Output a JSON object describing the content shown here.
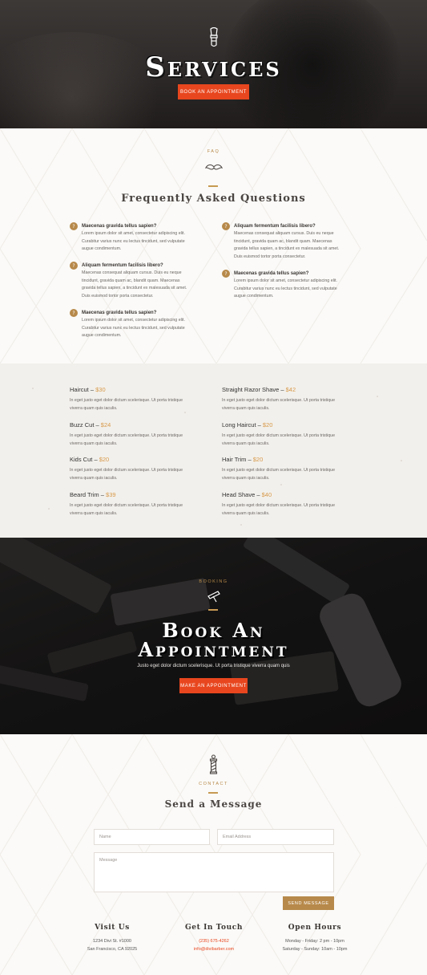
{
  "hero": {
    "title": "Services",
    "button": "Book An Appointment"
  },
  "faq": {
    "eyebrow": "FAQ",
    "title": "Frequently Asked Questions",
    "badge": "?",
    "left": [
      {
        "q": "Maecenas gravida tellus sapien?",
        "a": [
          "Lorem ipsum dolor sit amet, consectetur adipiscing elit.",
          "Curabitur varius nunc eu lectus tincidunt, sed vulputate",
          "augue condimentum."
        ]
      },
      {
        "q": "Aliquam fermentum facilisis libero?",
        "a": [
          "Maecenas consequat aliquam cursus. Duis eu neque",
          "tincidunt, gravida quam ac, blandit quam. Maecenas",
          "gravida tellus sapien, a tincidunt ex malesuada sit amet.",
          "Duis euismod tortor porta consectetur."
        ]
      },
      {
        "q": "Maecenas gravida tellus sapien?",
        "a": [
          "Lorem ipsum dolor sit amet, consectetur adipiscing elit.",
          "Curabitur varius nunc eu lectus tincidunt, sed vulputate",
          "augue condimentum."
        ]
      }
    ],
    "right": [
      {
        "q": "Aliquam fermentum facilisis libero?",
        "a": [
          "Maecenas consequat aliquam cursus. Duis eu neque",
          "tincidunt, gravida quam ac, blandit quam. Maecenas",
          "gravida tellus sapien, a tincidunt ex malesuada sit amet.",
          "Duis euismod tortor porta consectetur."
        ]
      },
      {
        "q": "Maecenas gravida tellus sapien?",
        "a": [
          "Lorem ipsum dolor sit amet, consectetur adipiscing elit.",
          "Curabitur varius nunc eu lectus tincidunt, sed vulputate",
          "augue condimentum."
        ]
      }
    ]
  },
  "prices": {
    "separator": " – ",
    "desc": [
      "In eget justo eget dolor dictum scelerisque. Ut porta tristique",
      "viverra quam quis iaculis."
    ],
    "left": [
      {
        "name": "Haircut",
        "price": "$30"
      },
      {
        "name": "Buzz Cut",
        "price": "$24"
      },
      {
        "name": "Kids Cut",
        "price": "$20"
      },
      {
        "name": "Beard Trim",
        "price": "$39"
      }
    ],
    "right": [
      {
        "name": "Straight Razor Shave",
        "price": "$42"
      },
      {
        "name": "Long Haircut",
        "price": "$20"
      },
      {
        "name": "Hair Trim",
        "price": "$20"
      },
      {
        "name": "Head Shave",
        "price": "$40"
      }
    ]
  },
  "booking": {
    "eyebrow": "Booking",
    "title_line1": "Book An",
    "title_line2": "Appointment",
    "subtitle": "Justo eget dolor dictum scelerisque. Ut porta tristique viverra quam quis",
    "button": "Make An Appointment"
  },
  "contact": {
    "eyebrow": "Contact",
    "title": "Send a Message",
    "name_placeholder": "Name",
    "email_placeholder": "Email Address",
    "message_placeholder": "Message",
    "send_button": "Send Message"
  },
  "footer": {
    "visit": {
      "title": "Visit Us",
      "line1": "1234 Divi St. #1000",
      "line2": "San Francisco, CA 92025"
    },
    "touch": {
      "title": "Get In Touch",
      "phone": "(235) 675-4262",
      "email": "info@divibarber.com"
    },
    "hours": {
      "title": "Open Hours",
      "line1": "Monday - Friday: 2 pm - 10pm",
      "line2": "Saturday - Sunday: 10am - 10pm"
    }
  },
  "colors": {
    "accent_orange": "#e8461e",
    "gold": "#b7894a",
    "price_gold": "#d79a4a",
    "dark": "#1a1818"
  }
}
